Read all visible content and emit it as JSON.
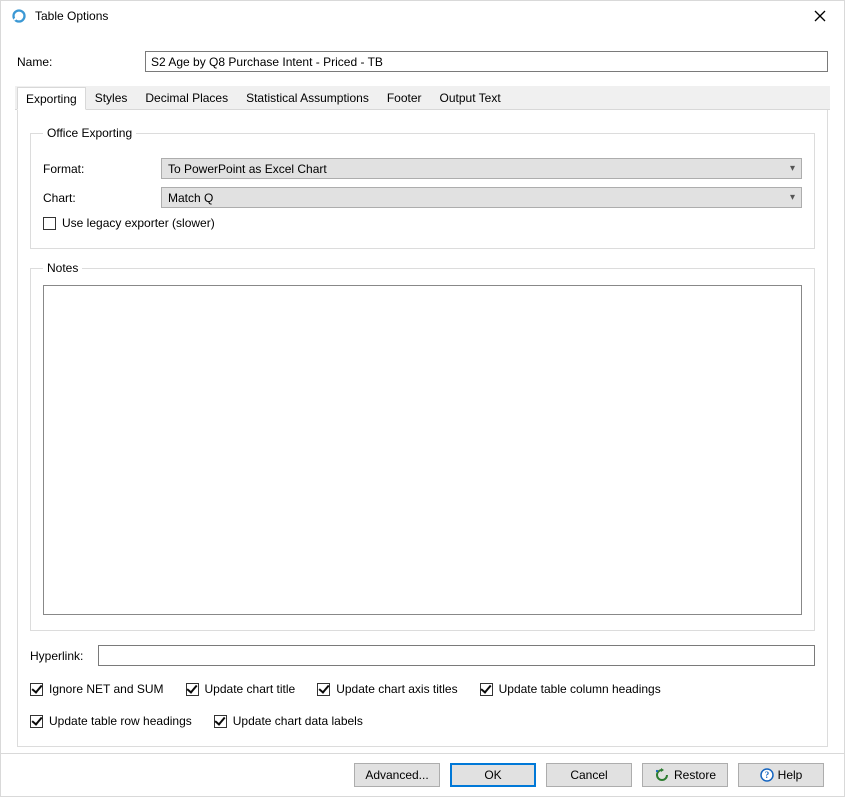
{
  "window": {
    "title": "Table Options"
  },
  "name": {
    "label": "Name:",
    "value": "S2 Age by Q8 Purchase Intent - Priced - TB"
  },
  "tabs": [
    {
      "label": "Exporting",
      "active": true
    },
    {
      "label": "Styles"
    },
    {
      "label": "Decimal Places"
    },
    {
      "label": "Statistical Assumptions"
    },
    {
      "label": "Footer"
    },
    {
      "label": "Output Text"
    }
  ],
  "office_exporting": {
    "legend": "Office Exporting",
    "format_label": "Format:",
    "format_value": "To PowerPoint as Excel Chart",
    "chart_label": "Chart:",
    "chart_value": "Match Q",
    "legacy_label": "Use legacy exporter (slower)",
    "legacy_checked": false
  },
  "notes": {
    "legend": "Notes",
    "value": ""
  },
  "hyperlink": {
    "label": "Hyperlink:",
    "value": ""
  },
  "checks": [
    {
      "label": "Ignore NET and SUM",
      "checked": true
    },
    {
      "label": "Update chart title",
      "checked": true
    },
    {
      "label": "Update chart axis titles",
      "checked": true
    },
    {
      "label": "Update table column headings",
      "checked": true
    },
    {
      "label": "Update table row headings",
      "checked": true
    },
    {
      "label": "Update chart data labels",
      "checked": true
    }
  ],
  "buttons": {
    "advanced": "Advanced...",
    "ok": "OK",
    "cancel": "Cancel",
    "restore": "Restore",
    "help": "Help"
  }
}
